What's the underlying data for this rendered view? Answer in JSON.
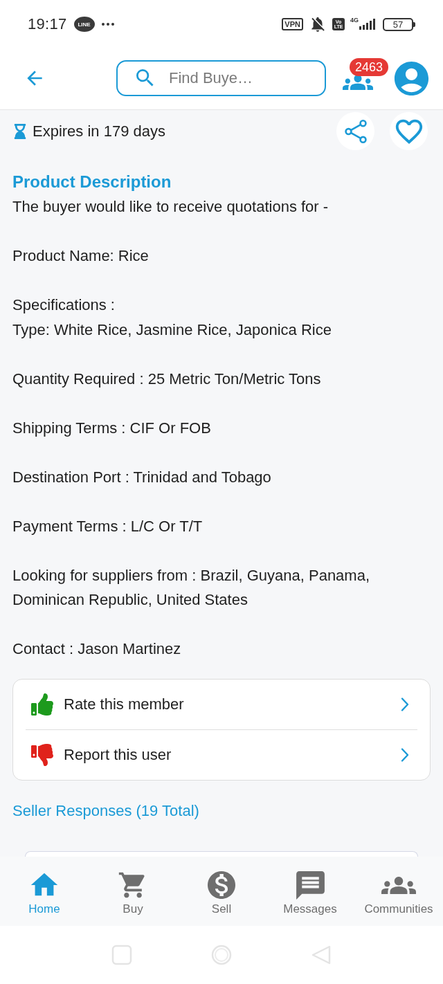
{
  "status_bar": {
    "time": "19:17",
    "app_badge": "LINE",
    "vpn": "VPN",
    "volte_top": "Vo",
    "volte_bottom": "LTE",
    "network": "4G",
    "battery": "57"
  },
  "header": {
    "search": {
      "placeholder": "Find Buye…"
    },
    "notification_count": "2463"
  },
  "listing": {
    "expires": "Expires in 179 days",
    "favorited": false,
    "description_title": "Product Description",
    "paragraphs": [
      [
        "The buyer would like to receive quotations for -"
      ],
      [
        "Product Name: Rice"
      ],
      [
        "Specifications :",
        "Type: White Rice, Jasmine Rice, Japonica Rice"
      ],
      [
        "Quantity Required : 25 Metric Ton/Metric Tons"
      ],
      [
        "Shipping Terms : CIF Or FOB"
      ],
      [
        "Destination Port : Trinidad and Tobago"
      ],
      [
        "Payment Terms : L/C Or T/T"
      ],
      [
        "Looking for suppliers from : Brazil, Guyana, Panama, Dominican Republic, United States"
      ],
      [
        "Contact : Jason Martinez"
      ]
    ]
  },
  "member_actions": [
    {
      "kind": "rate",
      "label": "Rate this member"
    },
    {
      "kind": "report",
      "label": "Report this user"
    }
  ],
  "responses": {
    "title": "Seller Responses (19 Total)"
  },
  "bottom_nav": [
    {
      "kind": "home",
      "label": "Home",
      "selected": true
    },
    {
      "kind": "buy",
      "label": "Buy",
      "selected": false
    },
    {
      "kind": "sell",
      "label": "Sell",
      "selected": false
    },
    {
      "kind": "messages",
      "label": "Messages",
      "selected": false
    },
    {
      "kind": "communities",
      "label": "Communities",
      "selected": false
    }
  ]
}
